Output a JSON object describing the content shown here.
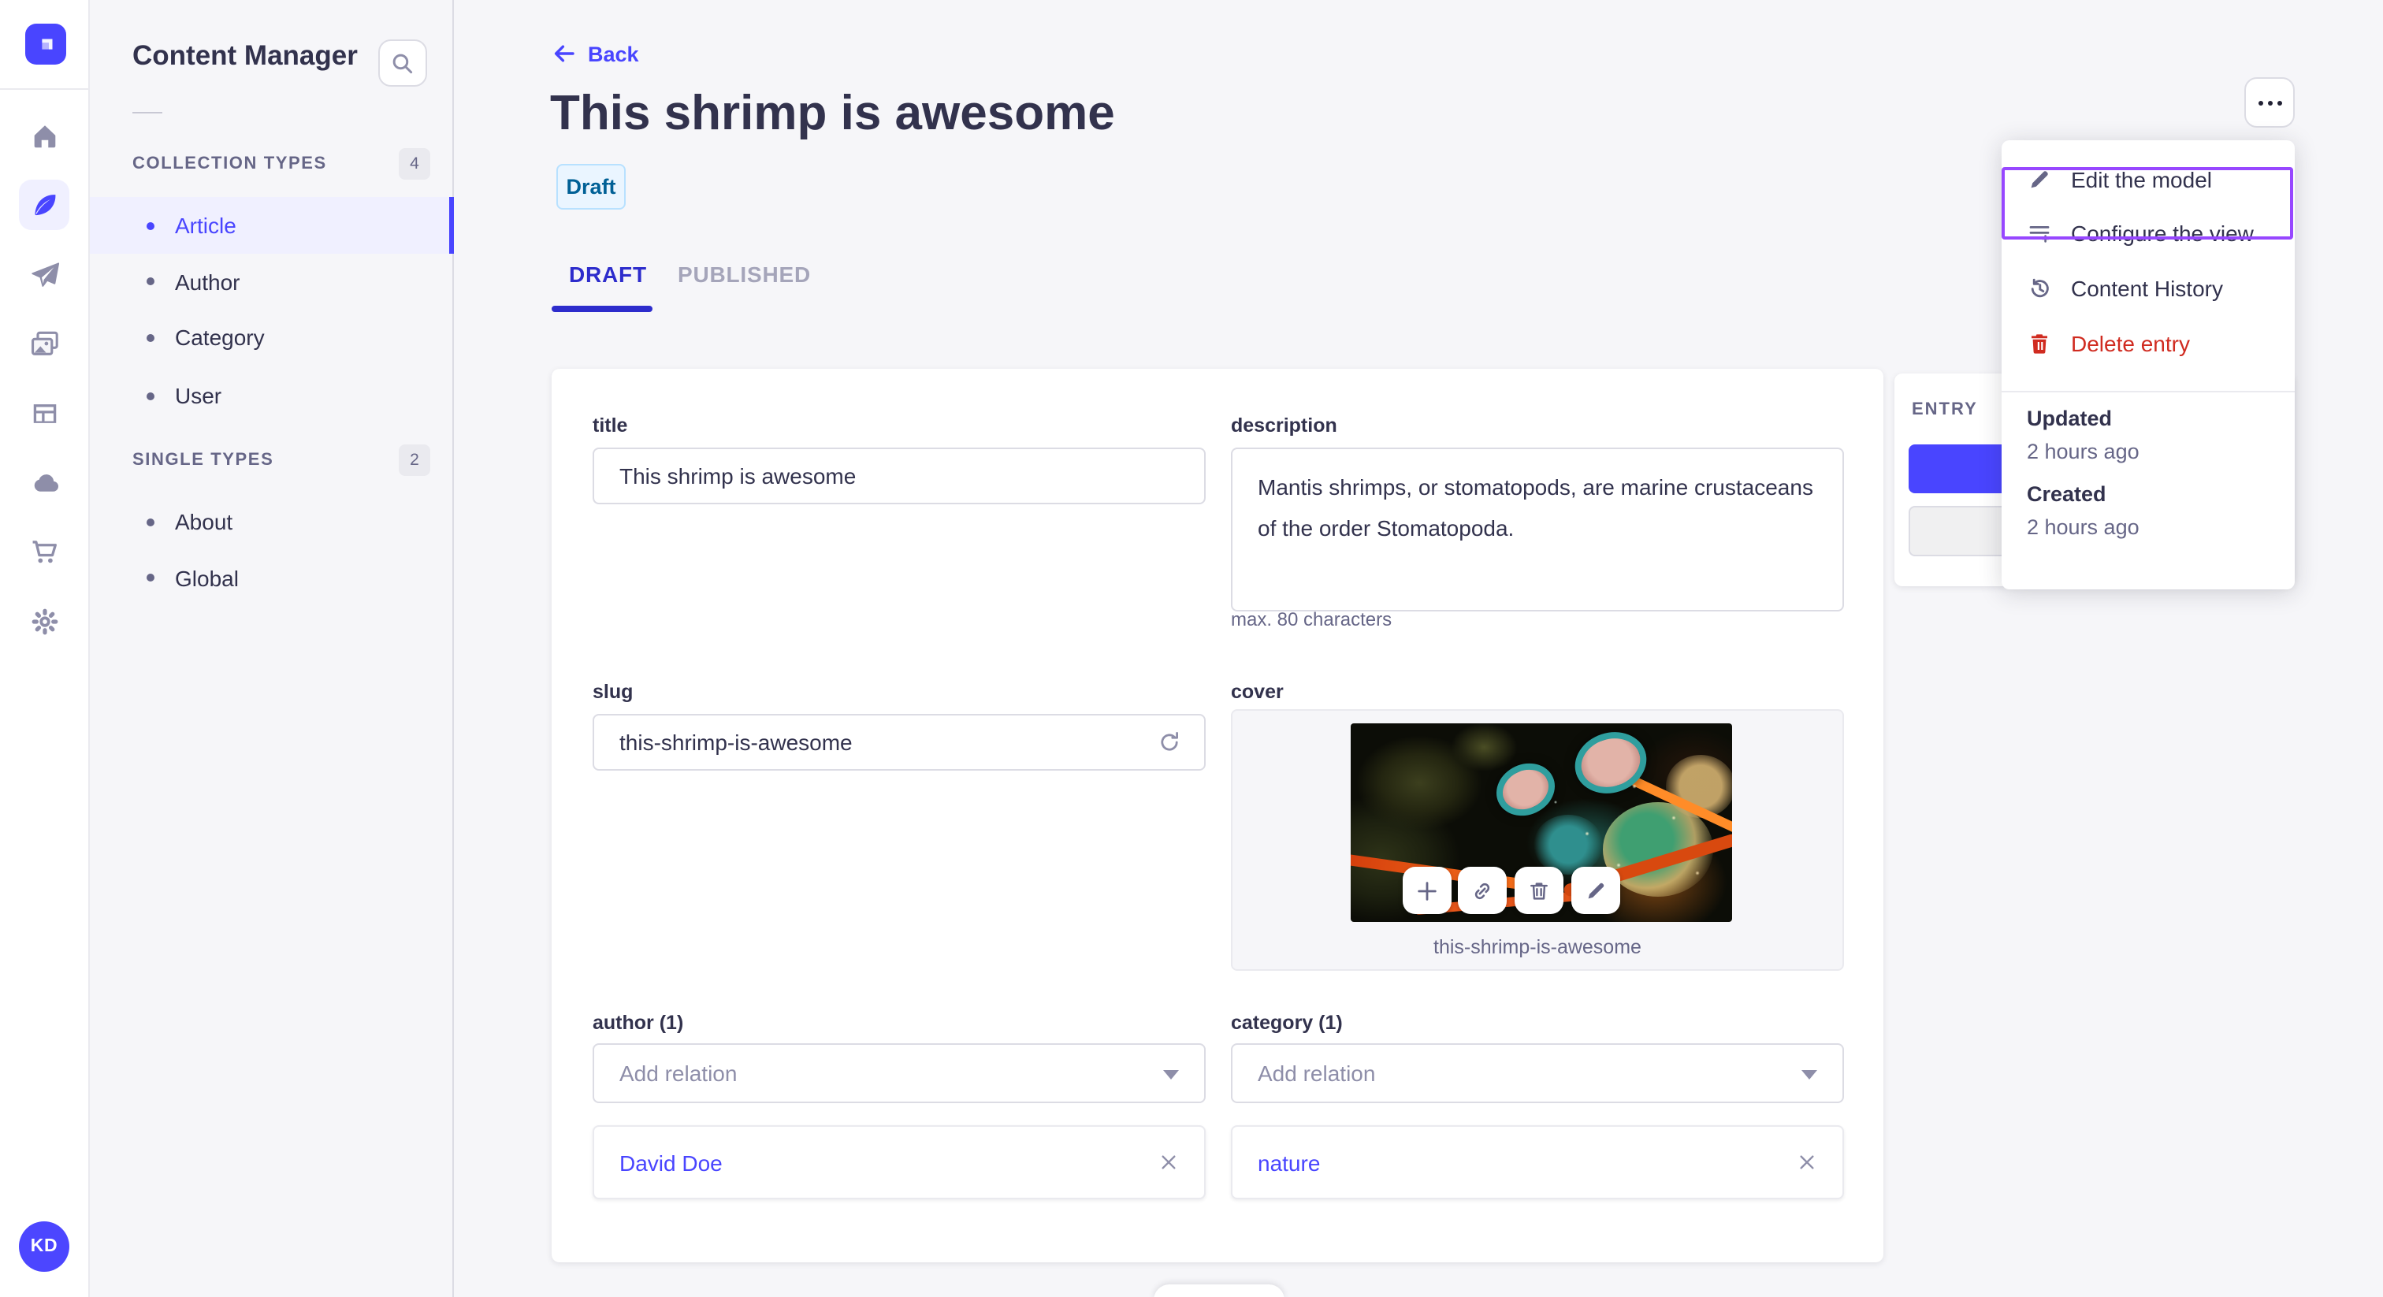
{
  "colors": {
    "accent": "#4945ff",
    "accent_bg": "#f0f0ff",
    "danger": "#d02b20",
    "highlight_box": "#9747ff",
    "draft_bg": "#eaf5ff",
    "draft_border": "#b8e1ff",
    "draft_text": "#006096"
  },
  "navbar": {
    "logo_icon": "strapi-logo",
    "avatar_initials": "KD"
  },
  "subnav": {
    "title": "Content Manager",
    "sections": [
      {
        "label": "COLLECTION TYPES",
        "count": "4",
        "items": [
          {
            "label": "Article"
          },
          {
            "label": "Author"
          },
          {
            "label": "Category"
          },
          {
            "label": "User"
          }
        ]
      },
      {
        "label": "SINGLE TYPES",
        "count": "2",
        "items": [
          {
            "label": "About"
          },
          {
            "label": "Global"
          }
        ]
      }
    ]
  },
  "header": {
    "back_label": "Back",
    "title": "This shrimp is awesome",
    "status_badge": "Draft",
    "tabs": [
      {
        "label": "DRAFT"
      },
      {
        "label": "PUBLISHED"
      }
    ]
  },
  "form": {
    "title_field": {
      "label": "title",
      "value": "This shrimp is awesome"
    },
    "description_field": {
      "label": "description",
      "value": "Mantis shrimps, or stomatopods, are marine crustaceans of the order Stomatopoda.",
      "hint": "max. 80 characters"
    },
    "slug_field": {
      "label": "slug",
      "value": "this-shrimp-is-awesome"
    },
    "cover_field": {
      "label": "cover",
      "caption": "this-shrimp-is-awesome"
    },
    "author_field": {
      "label": "author (1)",
      "placeholder": "Add relation",
      "relations": [
        {
          "name": "David Doe"
        }
      ]
    },
    "category_field": {
      "label": "category (1)",
      "placeholder": "Add relation",
      "relations": [
        {
          "name": "nature"
        }
      ]
    }
  },
  "entry_panel": {
    "label": "ENTRY"
  },
  "context_menu": {
    "items": [
      {
        "label": "Edit the model"
      },
      {
        "label": "Configure the view"
      },
      {
        "label": "Content History"
      },
      {
        "label": "Delete entry"
      }
    ],
    "info": [
      {
        "label": "Updated",
        "value": "2 hours ago"
      },
      {
        "label": "Created",
        "value": "2 hours ago"
      }
    ]
  }
}
